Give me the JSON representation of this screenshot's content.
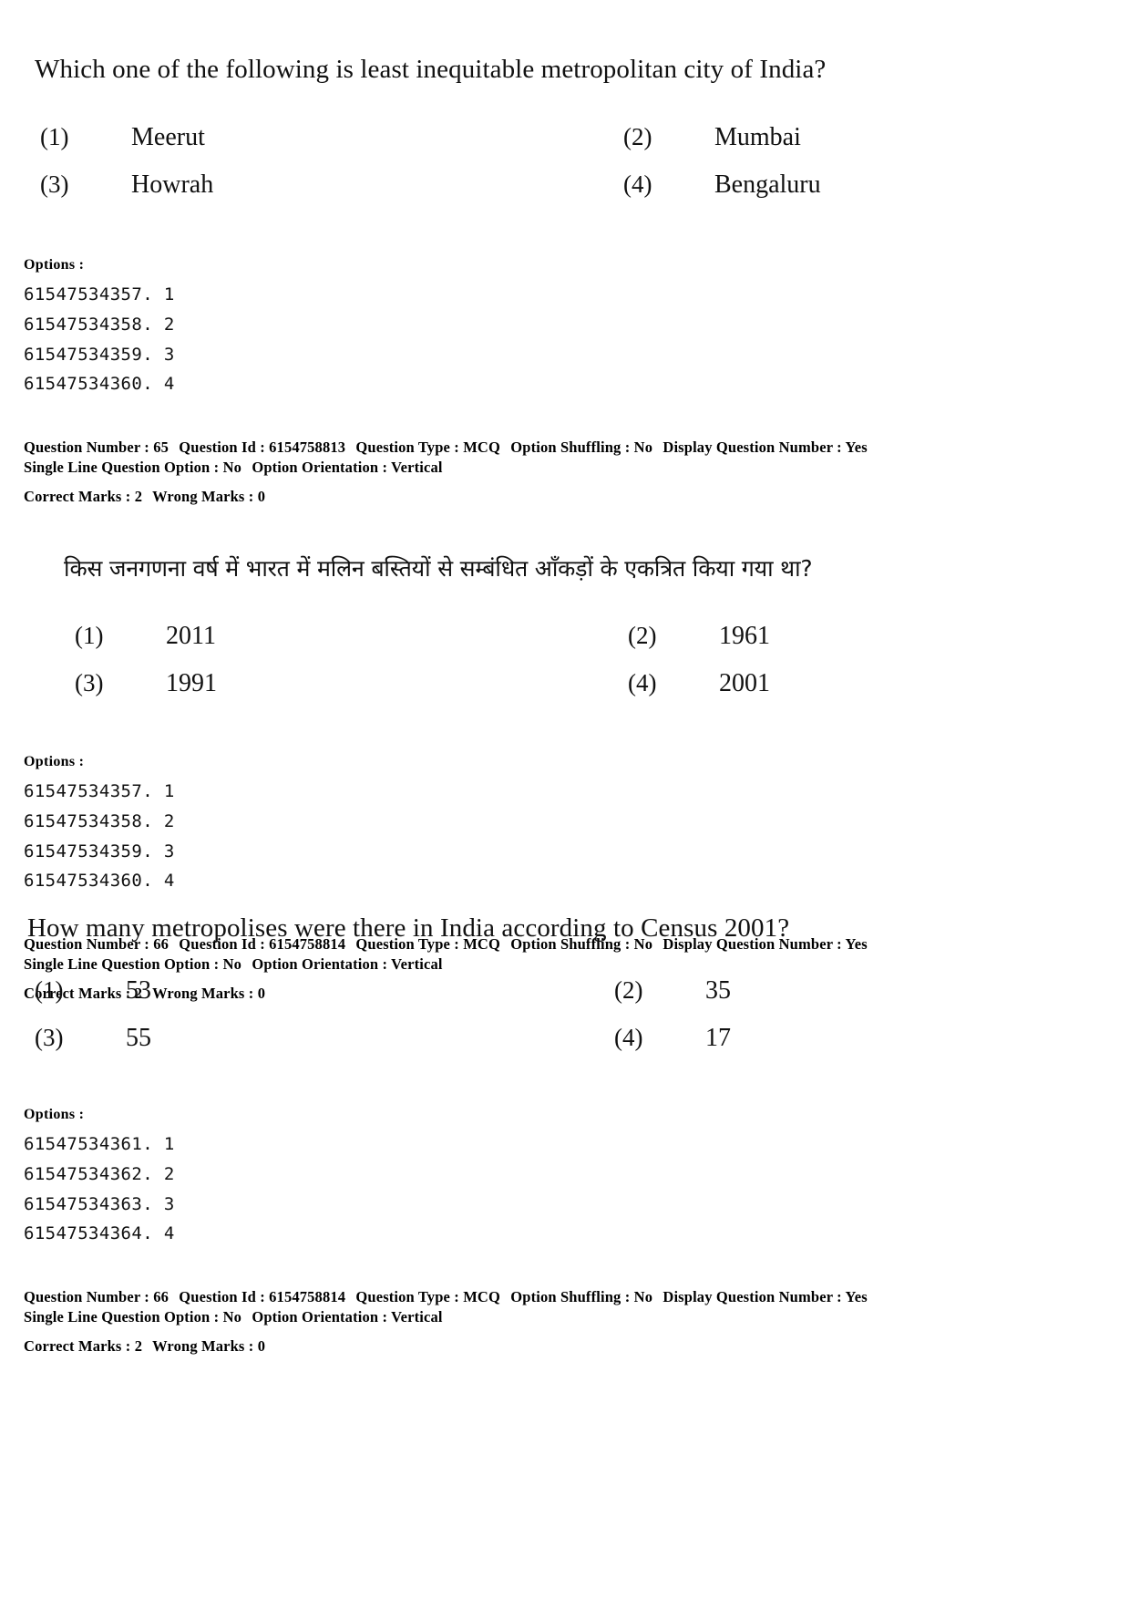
{
  "page": {
    "background": "#ffffff",
    "text_color": "#111111"
  },
  "questions": [
    {
      "text": "Which one of the following is least inequitable metropolitan city of India?",
      "language": "english",
      "choices": [
        {
          "num": "(1)",
          "text": "Meerut"
        },
        {
          "num": "(2)",
          "text": "Mumbai"
        },
        {
          "num": "(3)",
          "text": "Howrah"
        },
        {
          "num": "(4)",
          "text": "Bengaluru"
        }
      ],
      "options_label": "Options :",
      "option_ids": [
        "61547534357. 1",
        "61547534358. 2",
        "61547534359. 3",
        "61547534360. 4"
      ],
      "meta": {
        "question_number_label": "Question Number :",
        "question_number": "65",
        "question_id_label": "Question Id :",
        "question_id": "6154758813",
        "question_type_label": "Question Type :",
        "question_type": "MCQ",
        "option_shuffling_label": "Option Shuffling :",
        "option_shuffling": "No",
        "display_question_number_label": "Display Question Number :",
        "display_question_number": "Yes",
        "single_line_question_option_label": "Single Line Question Option :",
        "single_line_question_option": "No",
        "option_orientation_label": "Option Orientation :",
        "option_orientation": "Vertical",
        "correct_marks_label": "Correct Marks :",
        "correct_marks": "2",
        "wrong_marks_label": "Wrong Marks :",
        "wrong_marks": "0"
      }
    },
    {
      "text": "किस जनगणना वर्ष में भारत में मलिन बस्तियों से सम्बंधित आँकड़ों के एकत्रित किया गया था?",
      "language": "hindi",
      "choices": [
        {
          "num": "(1)",
          "text": "2011"
        },
        {
          "num": "(2)",
          "text": "1961"
        },
        {
          "num": "(3)",
          "text": "1991"
        },
        {
          "num": "(4)",
          "text": "2001"
        }
      ],
      "options_label": "Options :",
      "option_ids": [
        "61547534357. 1",
        "61547534358. 2",
        "61547534359. 3",
        "61547534360. 4"
      ],
      "meta": {
        "question_number_label": "Question Number :",
        "question_number": "66",
        "question_id_label": "Question Id :",
        "question_id": "6154758814",
        "question_type_label": "Question Type :",
        "question_type": "MCQ",
        "option_shuffling_label": "Option Shuffling :",
        "option_shuffling": "No",
        "display_question_number_label": "Display Question Number :",
        "display_question_number": "Yes",
        "single_line_question_option_label": "Single Line Question Option :",
        "single_line_question_option": "No",
        "option_orientation_label": "Option Orientation :",
        "option_orientation": "Vertical",
        "correct_marks_label": "Correct Marks :",
        "correct_marks": "2",
        "wrong_marks_label": "Wrong Marks :",
        "wrong_marks": "0"
      }
    },
    {
      "text": "How many metropolises were there in India according to Census 2001?",
      "language": "english",
      "choices": [
        {
          "num": "(1)",
          "text": "53"
        },
        {
          "num": "(2)",
          "text": "35"
        },
        {
          "num": "(3)",
          "text": "55"
        },
        {
          "num": "(4)",
          "text": "17"
        }
      ],
      "options_label": "Options :",
      "option_ids": [
        "61547534361. 1",
        "61547534362. 2",
        "61547534363. 3",
        "61547534364. 4"
      ],
      "meta": {
        "question_number_label": "Question Number :",
        "question_number": "66",
        "question_id_label": "Question Id :",
        "question_id": "6154758814",
        "question_type_label": "Question Type :",
        "question_type": "MCQ",
        "option_shuffling_label": "Option Shuffling :",
        "option_shuffling": "No",
        "display_question_number_label": "Display Question Number :",
        "display_question_number": "Yes",
        "single_line_question_option_label": "Single Line Question Option :",
        "single_line_question_option": "No",
        "option_orientation_label": "Option Orientation :",
        "option_orientation": "Vertical",
        "correct_marks_label": "Correct Marks :",
        "correct_marks": "2",
        "wrong_marks_label": "Wrong Marks :",
        "wrong_marks": "0"
      }
    }
  ]
}
